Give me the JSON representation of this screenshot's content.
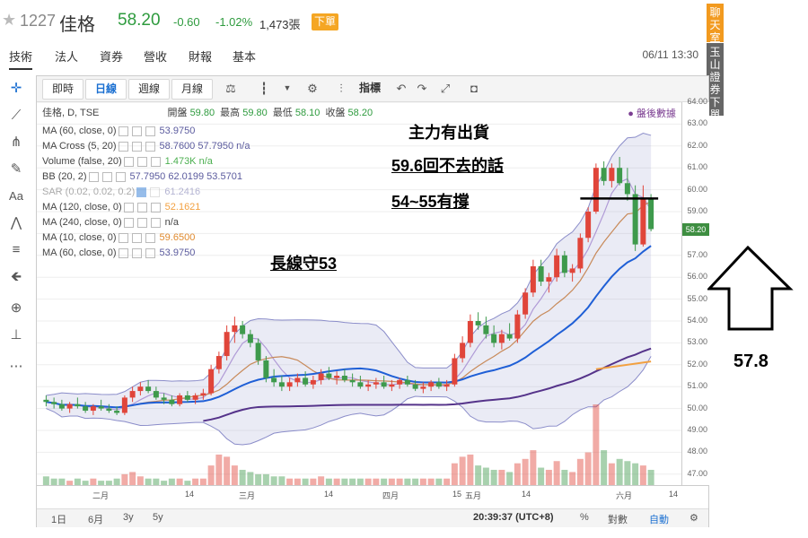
{
  "header": {
    "star": "★",
    "code": "1227",
    "name": "佳格",
    "price": "58.20",
    "change": "-0.60",
    "percent": "-1.02%",
    "volume": "1,473張",
    "order_button": "下單"
  },
  "tabs": [
    "技術",
    "法人",
    "資券",
    "營收",
    "財報",
    "基本"
  ],
  "datetime": "06/11 13:30",
  "side_tabs": {
    "chat": "聊天室",
    "broker": "玉山證券下單"
  },
  "toolbar": {
    "periods": [
      "即時",
      "日線",
      "週線",
      "月線"
    ],
    "active_period": "日線",
    "indicators_label": "指標"
  },
  "chart_header": {
    "title": "佳格, D, TSE",
    "open_label": "開盤",
    "open": "59.80",
    "high_label": "最高",
    "high": "59.80",
    "low_label": "最低",
    "low": "58.10",
    "close_label": "收盤",
    "close": "58.20",
    "after_hours": "● 盤後數據"
  },
  "legend": [
    {
      "label": "MA (60, close, 0)",
      "value": "53.9750"
    },
    {
      "label": "MA Cross (5, 20)",
      "value": "58.7600 57.7950 n/a"
    },
    {
      "label": "Volume (false, 20)",
      "value": "1.473K n/a"
    },
    {
      "label": "BB (20, 2)",
      "value": "57.7950 62.0199 53.5701"
    },
    {
      "label": "SAR (0.02, 0.02, 0.2)",
      "value": "61.2416"
    },
    {
      "label": "MA (120, close, 0)",
      "value": "52.1621"
    },
    {
      "label": "MA (240, close, 0)",
      "value": "n/a"
    },
    {
      "label": "MA (10, close, 0)",
      "value": "59.6500"
    },
    {
      "label": "MA (60, close, 0)",
      "value": "53.9750"
    }
  ],
  "annotations": {
    "main_selling": "主力有出貨",
    "not_return": "59.6回不去的話",
    "support": "54~55有撐",
    "long_hold": "長線守53",
    "side_value": "57.8"
  },
  "bottom_bar": {
    "ranges": [
      "1日",
      "6月",
      "3y",
      "5y"
    ],
    "time": "20:39:37 (UTC+8)",
    "percent": "%",
    "log": "對數",
    "auto": "自動"
  },
  "colors": {
    "up": "#e0453a",
    "down": "#3e9a4c",
    "bb": "#8a8cc9",
    "ma_blue": "#1f5fd6",
    "ma_purple": "#55338a",
    "ma_orange": "#f2a040"
  },
  "chart_data": {
    "type": "candlestick",
    "ylim": [
      46.5,
      64
    ],
    "y_ticks": [
      "64.00",
      "63.00",
      "62.00",
      "61.00",
      "60.00",
      "59.00",
      "58.00",
      "57.00",
      "56.00",
      "55.00",
      "54.00",
      "53.00",
      "52.00",
      "51.00",
      "50.00",
      "49.00",
      "48.00",
      "47.00"
    ],
    "x_ticks": [
      "二月",
      "14",
      "三月",
      "14",
      "四月",
      "15",
      "五月",
      "14",
      "六月",
      "14"
    ],
    "current_price": "58.20",
    "candles": [
      [
        50.4,
        50.6,
        50.1,
        50.3
      ],
      [
        50.3,
        50.5,
        50.0,
        50.2
      ],
      [
        50.2,
        50.4,
        49.9,
        50.0
      ],
      [
        50.0,
        50.3,
        49.8,
        50.2
      ],
      [
        50.2,
        50.5,
        50.0,
        50.1
      ],
      [
        50.1,
        50.3,
        49.8,
        49.9
      ],
      [
        49.9,
        50.2,
        49.7,
        50.1
      ],
      [
        50.1,
        50.4,
        49.9,
        50.0
      ],
      [
        50.0,
        50.2,
        49.8,
        49.9
      ],
      [
        49.9,
        50.1,
        49.7,
        49.8
      ],
      [
        49.8,
        50.6,
        49.7,
        50.5
      ],
      [
        50.5,
        51.0,
        50.3,
        50.8
      ],
      [
        50.8,
        51.2,
        50.6,
        51.0
      ],
      [
        51.0,
        51.3,
        50.7,
        50.8
      ],
      [
        50.8,
        51.0,
        50.4,
        50.5
      ],
      [
        50.5,
        50.7,
        50.2,
        50.4
      ],
      [
        50.4,
        50.6,
        50.1,
        50.2
      ],
      [
        50.2,
        50.7,
        50.1,
        50.6
      ],
      [
        50.6,
        50.8,
        50.3,
        50.4
      ],
      [
        50.4,
        50.7,
        50.2,
        50.6
      ],
      [
        50.6,
        50.9,
        50.4,
        50.7
      ],
      [
        50.7,
        52.0,
        50.6,
        51.8
      ],
      [
        51.8,
        52.6,
        51.6,
        52.4
      ],
      [
        52.4,
        53.8,
        52.2,
        53.5
      ],
      [
        53.5,
        54.2,
        53.0,
        53.8
      ],
      [
        53.8,
        54.0,
        53.2,
        53.4
      ],
      [
        53.4,
        53.6,
        52.8,
        53.0
      ],
      [
        53.0,
        53.2,
        52.0,
        52.2
      ],
      [
        52.2,
        52.4,
        51.2,
        51.4
      ],
      [
        51.4,
        51.8,
        51.0,
        51.2
      ],
      [
        51.2,
        51.5,
        50.8,
        51.0
      ],
      [
        51.0,
        51.4,
        50.8,
        51.2
      ],
      [
        51.2,
        51.6,
        51.0,
        51.4
      ],
      [
        51.4,
        51.7,
        51.0,
        51.1
      ],
      [
        51.1,
        51.5,
        50.9,
        51.3
      ],
      [
        51.3,
        51.8,
        51.1,
        51.6
      ],
      [
        51.6,
        51.9,
        51.3,
        51.4
      ],
      [
        51.4,
        51.7,
        51.1,
        51.5
      ],
      [
        51.5,
        51.8,
        51.2,
        51.3
      ],
      [
        51.3,
        51.6,
        51.0,
        51.2
      ],
      [
        51.2,
        51.5,
        50.9,
        51.0
      ],
      [
        51.0,
        51.3,
        50.8,
        51.1
      ],
      [
        51.1,
        51.4,
        50.9,
        51.2
      ],
      [
        51.2,
        51.5,
        50.9,
        51.0
      ],
      [
        51.0,
        51.3,
        50.8,
        51.1
      ],
      [
        51.1,
        51.4,
        50.9,
        51.3
      ],
      [
        51.3,
        51.5,
        51.0,
        51.1
      ],
      [
        51.1,
        51.3,
        50.8,
        50.9
      ],
      [
        50.9,
        51.2,
        50.7,
        51.0
      ],
      [
        51.0,
        51.3,
        50.8,
        51.2
      ],
      [
        51.2,
        51.4,
        50.9,
        51.0
      ],
      [
        51.0,
        51.3,
        50.8,
        51.1
      ],
      [
        51.1,
        52.5,
        51.0,
        52.3
      ],
      [
        52.3,
        53.3,
        52.1,
        53.0
      ],
      [
        53.0,
        54.3,
        52.8,
        54.0
      ],
      [
        54.0,
        54.4,
        53.6,
        53.8
      ],
      [
        53.8,
        54.2,
        53.2,
        53.4
      ],
      [
        53.4,
        53.8,
        52.8,
        53.0
      ],
      [
        53.0,
        53.6,
        52.7,
        53.4
      ],
      [
        53.4,
        53.9,
        53.1,
        53.2
      ],
      [
        53.2,
        54.5,
        53.0,
        54.3
      ],
      [
        54.3,
        55.5,
        54.1,
        55.3
      ],
      [
        55.3,
        56.8,
        55.1,
        56.5
      ],
      [
        56.5,
        56.8,
        55.6,
        55.8
      ],
      [
        55.8,
        56.2,
        55.3,
        56.0
      ],
      [
        56.0,
        57.3,
        55.8,
        57.0
      ],
      [
        57.0,
        57.2,
        56.0,
        56.2
      ],
      [
        56.2,
        56.6,
        55.8,
        56.4
      ],
      [
        56.4,
        58.0,
        56.2,
        57.8
      ],
      [
        57.8,
        59.2,
        57.6,
        59.0
      ],
      [
        59.0,
        61.2,
        58.9,
        61.0
      ],
      [
        61.0,
        61.3,
        60.2,
        60.4
      ],
      [
        60.4,
        61.2,
        60.1,
        61.0
      ],
      [
        61.0,
        61.5,
        60.2,
        60.3
      ],
      [
        60.3,
        61.0,
        59.5,
        59.8
      ],
      [
        59.8,
        60.2,
        57.2,
        57.5
      ],
      [
        57.5,
        60.2,
        57.4,
        59.6
      ],
      [
        59.6,
        59.8,
        58.1,
        58.2
      ]
    ],
    "volumes": [
      4,
      3,
      3,
      2,
      3,
      2,
      3,
      2,
      2,
      3,
      5,
      6,
      4,
      3,
      3,
      2,
      3,
      3,
      2,
      3,
      3,
      9,
      14,
      13,
      9,
      7,
      6,
      5,
      5,
      4,
      4,
      3,
      3,
      3,
      3,
      4,
      3,
      3,
      3,
      3,
      3,
      3,
      3,
      3,
      3,
      3,
      3,
      3,
      3,
      3,
      3,
      3,
      10,
      13,
      14,
      9,
      8,
      7,
      7,
      6,
      10,
      12,
      16,
      8,
      7,
      11,
      7,
      6,
      12,
      15,
      37,
      16,
      10,
      12,
      11,
      10,
      9,
      7
    ]
  }
}
